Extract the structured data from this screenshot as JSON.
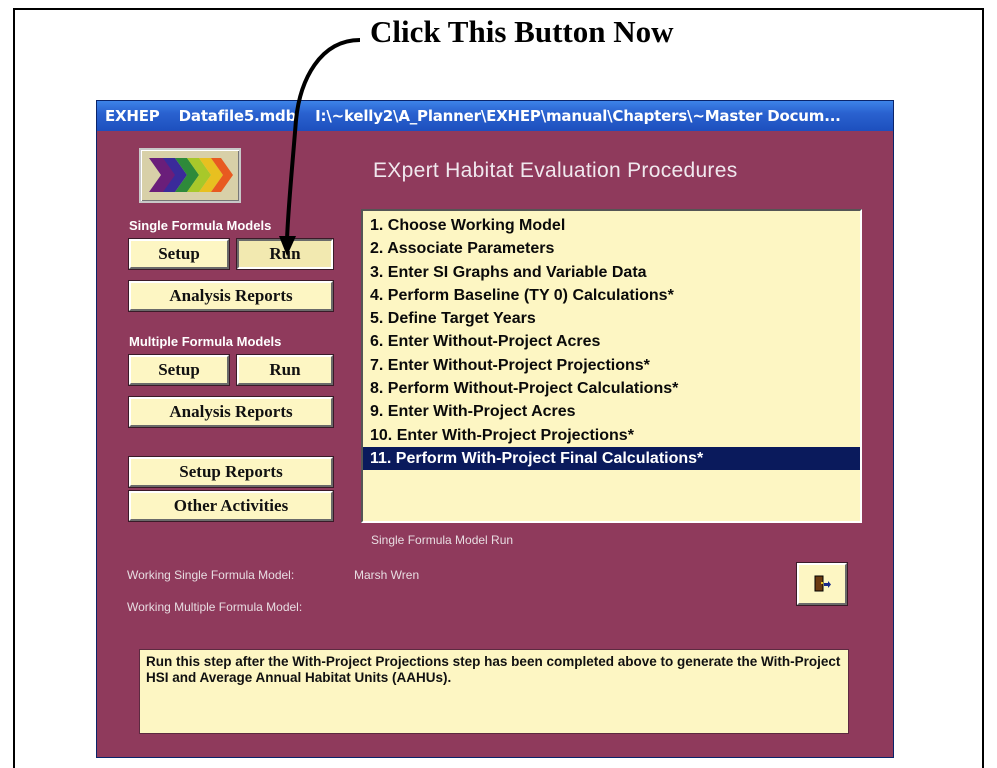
{
  "annotation": {
    "text": "Click This Button Now"
  },
  "window": {
    "title_parts": [
      "EXHEP",
      "Datafile5.mdb",
      "I:\\~kelly2\\A_Planner\\EXHEP\\manual\\Chapters\\~Master Docum..."
    ],
    "app_title": "EXpert Habitat Evaluation Procedures",
    "logo_icon": "colored-arrows-logo"
  },
  "single_formula": {
    "label": "Single Formula Models",
    "setup_label": "Setup",
    "run_label": "Run",
    "reports_label": "Analysis Reports"
  },
  "multiple_formula": {
    "label": "Multiple Formula Models",
    "setup_label": "Setup",
    "run_label": "Run",
    "reports_label": "Analysis Reports"
  },
  "other": {
    "setup_reports_label": "Setup Reports",
    "other_activities_label": "Other Activities"
  },
  "steps": [
    "1.  Choose Working Model",
    "2.  Associate Parameters",
    "3.  Enter SI Graphs and Variable Data",
    "4.  Perform Baseline (TY 0) Calculations*",
    "5.  Define Target Years",
    "6.  Enter Without-Project Acres",
    "7.  Enter Without-Project Projections*",
    "8.  Perform Without-Project Calculations*",
    "9.  Enter With-Project Acres",
    "10. Enter With-Project Projections*",
    "11. Perform With-Project Final Calculations*"
  ],
  "selected_step_index": 10,
  "status": {
    "mode_caption": "Single Formula Model Run",
    "working_single_label": "Working Single Formula Model:",
    "working_single_value": "Marsh Wren",
    "working_multiple_label": "Working Multiple Formula Model:",
    "working_multiple_value": ""
  },
  "exit_icon": "exit-door-icon",
  "info_text": "Run this step after the With-Project Projections step has been completed above to generate the With-Project HSI and Average Annual Habitat Units (AAHUs).",
  "colors": {
    "window_bg": "#8f3a5c",
    "button_bg": "#fdf6c3",
    "selection_bg": "#0a1a5c",
    "titlebar": "#2a62d0"
  }
}
